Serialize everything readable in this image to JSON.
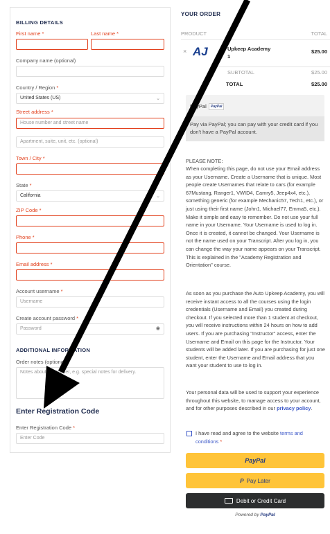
{
  "billing": {
    "title": "BILLING DETAILS",
    "first_name_label": "First name",
    "last_name_label": "Last name",
    "company_label": "Company name (optional)",
    "country_label": "Country / Region",
    "country_value": "United States (US)",
    "street_label": "Street address",
    "street_placeholder": "House number and street name",
    "apartment_placeholder": "Apartment, suite, unit, etc. (optional)",
    "town_label": "Town / City",
    "state_label": "State",
    "state_value": "California",
    "zip_label": "ZIP Code",
    "phone_label": "Phone",
    "email_label": "Email address",
    "username_label": "Account username",
    "username_placeholder": "Username",
    "password_label": "Create account password",
    "password_placeholder": "Password",
    "additional_title": "ADDITIONAL INFORMATION",
    "order_notes_label": "Order notes (optional)",
    "order_notes_placeholder": "Notes about your order, e.g. special notes for delivery.",
    "required_mark": "*"
  },
  "registration": {
    "title": "Enter Registration Code",
    "label": "Enter Registration Code",
    "placeholder": "Enter Code"
  },
  "order": {
    "title": "YOUR ORDER",
    "product_header": "PRODUCT",
    "total_header": "TOTAL",
    "product_name": "Upkeep Academy",
    "product_qty": "1",
    "product_price": "$25.00",
    "remove_symbol": "×",
    "subtotal_label": "SUBTOTAL",
    "subtotal_value": "$25.00",
    "total_label": "TOTAL",
    "total_value": "$25.00",
    "paypal_label": "PayPal",
    "paypal_badge": "PayPal",
    "paypal_desc": "Pay via PayPal; you can pay with your credit card if you don't have a PayPal account.",
    "note_heading": "PLEASE NOTE:",
    "note_p1": "When completing this page, do not use your Email address as your Username. Create a Username that is unique. Most people create Usernames that relate to cars (for example 67Mustang, Ranger1, VWID4, Camry5, Jeep4x4, etc.), something generic (for example Mechanic57, Tech1, etc.), or just using their first name (John1, Michael77, Emma5, etc.). Make it simple and easy to remember. Do not use your full name in your Username. Your Username is used to log in. Once it is created, it cannot be changed. Your Username is not the name used on your Transcript. After you log in, you can change the way your name appears on your Transcript. This is explained in the \"Academy Registration and Orientation\" course.",
    "note_p2": "As soon as you purchase the Auto Upkeep Academy, you will receive instant access to all the courses using the login credentials (Username and Email) you created during checkout. If you selected more than 1 student at checkout, you will receive instructions within 24 hours on how to add users. If you are purchasing \"Instructor\" access, enter the Username and Email on this page for the Instructor. Your students will be added later. If you are purchasing for just one student, enter the Username and Email address that you want your student to use to log in.",
    "privacy_text": "Your personal data will be used to support your experience throughout this website, to manage access to your account, and for other purposes described in our",
    "privacy_link": "privacy policy",
    "terms_text": "I have read and agree to the website",
    "terms_link": "terms and conditions",
    "btn_paypal": "PayPal",
    "btn_paylater": "Pay Later",
    "btn_card": "Debit or Credit Card",
    "powered_by": "Powered by",
    "powered_brand": "PayPal"
  },
  "colors": {
    "error": "#e2401c",
    "navy": "#1d2a4d",
    "paypal_yellow": "#ffc439",
    "paypal_blue": "#253b80",
    "paypal_light": "#179bd7",
    "link": "#3c58c8"
  }
}
